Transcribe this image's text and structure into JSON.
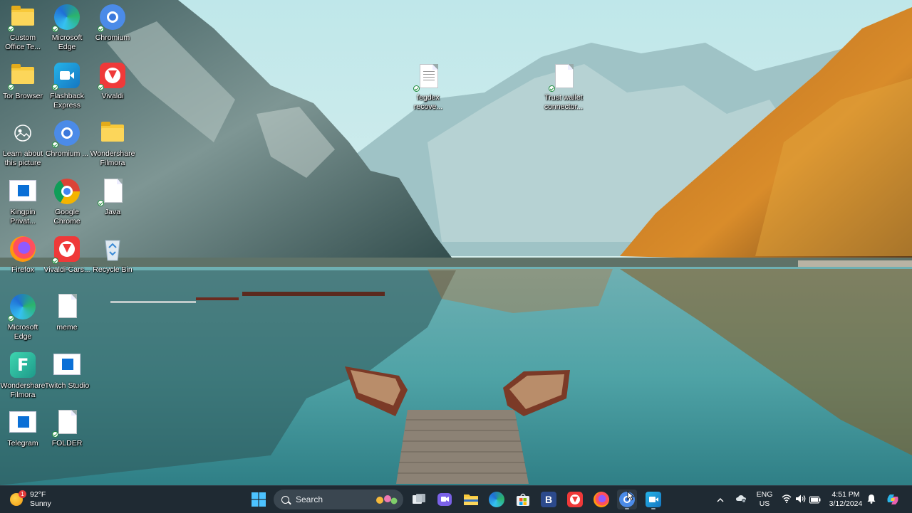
{
  "desktop": {
    "icons": [
      {
        "name": "custom-office-templates-folder",
        "label": "Custom Office Te...",
        "icon": "folder-icon"
      },
      {
        "name": "microsoft-edge-shortcut",
        "label": "Microsoft Edge",
        "icon": "edge-icon"
      },
      {
        "name": "chromium-shortcut",
        "label": "Chromium",
        "icon": "chromium-icon"
      },
      {
        "name": "tor-browser-folder",
        "label": "Tor Browser",
        "icon": "folder-icon"
      },
      {
        "name": "flashback-express-shortcut",
        "label": "Flashback Express",
        "icon": "flashback-icon"
      },
      {
        "name": "vivaldi-shortcut",
        "label": "Vivaldi",
        "icon": "vivaldi-icon"
      },
      {
        "name": "learn-about-picture-shortcut",
        "label": "Learn about this picture",
        "icon": "camera-icon"
      },
      {
        "name": "chromium-2-shortcut",
        "label": "Chromium ...",
        "icon": "chromium-icon"
      },
      {
        "name": "wondershare-filmora-folder",
        "label": "Wondershare Filmora",
        "icon": "folder-icon"
      },
      {
        "name": "kingpin-private-shortcut",
        "label": "Kingpin Privat...",
        "icon": "app-window-icon"
      },
      {
        "name": "google-chrome-shortcut",
        "label": "Google Chrome",
        "icon": "chrome-icon"
      },
      {
        "name": "java-file",
        "label": "Java",
        "icon": "document-icon"
      },
      {
        "name": "firefox-shortcut",
        "label": "Firefox",
        "icon": "firefox-icon"
      },
      {
        "name": "vivaldi-cars-shortcut",
        "label": "Vivaldi-Cars...",
        "icon": "vivaldi-icon"
      },
      {
        "name": "recycle-bin",
        "label": "Recycle Bin",
        "icon": "recycle-bin-icon"
      },
      {
        "name": "microsoft-edge-2-shortcut",
        "label": "Microsoft Edge",
        "icon": "edge-icon"
      },
      {
        "name": "meme-file",
        "label": "meme",
        "icon": "document-icon"
      },
      {
        "name": "wondershare-filmora-shortcut",
        "label": "Wondershare Filmora",
        "icon": "filmora-icon"
      },
      {
        "name": "twitch-studio-shortcut",
        "label": "Twitch Studio",
        "icon": "app-window-icon"
      },
      {
        "name": "telegram-shortcut",
        "label": "Telegram",
        "icon": "app-window-icon"
      },
      {
        "name": "folder-file",
        "label": "FOLDER",
        "icon": "document-icon"
      },
      {
        "name": "fegdex-recovery-file",
        "label": "fegdex recove...",
        "icon": "text-document-icon"
      },
      {
        "name": "trust-wallet-file",
        "label": "Trust wallet connector...",
        "icon": "document-icon"
      }
    ]
  },
  "taskbar": {
    "weather": {
      "temp": "92°F",
      "condition": "Sunny",
      "badge": "1"
    },
    "search_placeholder": "Search",
    "apps": [
      {
        "name": "start-button",
        "icon": "windows-logo-icon"
      },
      {
        "name": "task-view-button",
        "icon": "task-view-icon"
      },
      {
        "name": "teams-chat-button",
        "icon": "chat-icon"
      },
      {
        "name": "file-explorer-button",
        "icon": "folder-icon"
      },
      {
        "name": "edge-taskbar-button",
        "icon": "edge-icon"
      },
      {
        "name": "store-button",
        "icon": "store-icon"
      },
      {
        "name": "b-app-button",
        "icon": "b-icon"
      },
      {
        "name": "vivaldi-taskbar-button",
        "icon": "vivaldi-icon"
      },
      {
        "name": "firefox-taskbar-button",
        "icon": "firefox-icon"
      },
      {
        "name": "chromium-taskbar-button",
        "icon": "chromium-icon"
      },
      {
        "name": "flashback-taskbar-button",
        "icon": "flashback-icon"
      }
    ],
    "tray": {
      "lang_line1": "ENG",
      "lang_line2": "US",
      "time": "4:51 PM",
      "date": "3/12/2024"
    }
  },
  "colors": {
    "taskbar_bg": "#1f2a33",
    "accent_blue": "#0a6fd6"
  }
}
